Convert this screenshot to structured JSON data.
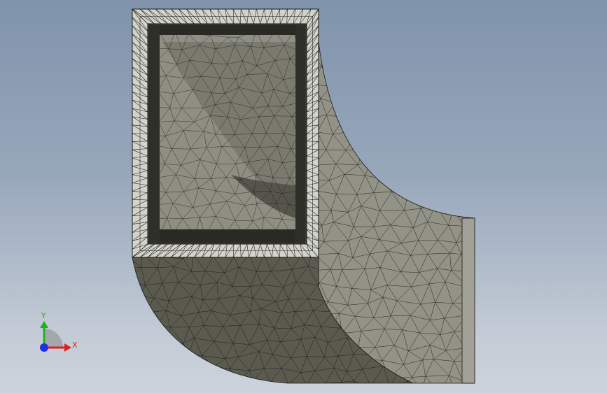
{
  "viewport": {
    "background_top": "#7f93ab",
    "background_bottom": "#ccd3dc",
    "mesh_line_color": "#1a1a1a",
    "frame_face_color": "#d4d3cb",
    "outer_wall_color": "#929286",
    "inner_wall_color": "#7d7d72",
    "front_face_color": "#5e5e53",
    "bottom_face_color": "#5a5a4f"
  },
  "triad": {
    "x_label": "X",
    "y_label": "Y",
    "x_color": "#e0201c",
    "y_color": "#21b021",
    "z_color": "#1d2fe0",
    "icon": "coordinate-triad-icon"
  }
}
